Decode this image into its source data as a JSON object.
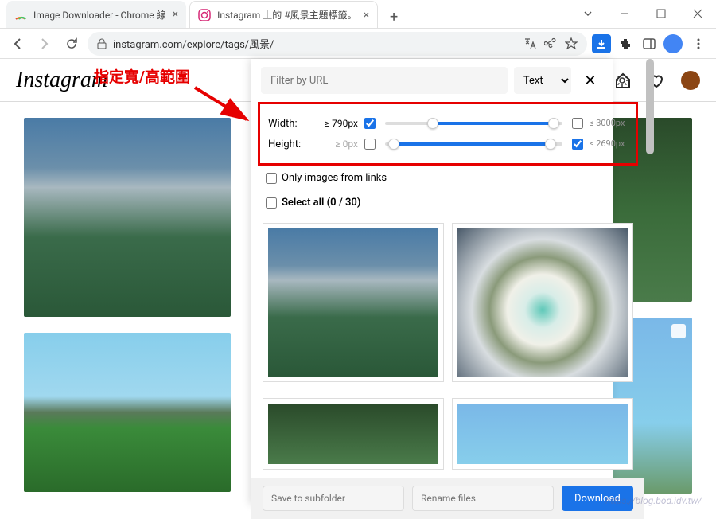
{
  "window": {
    "tabs": [
      {
        "title": "Image Downloader - Chrome 線",
        "active": false
      },
      {
        "title": "Instagram 上的 #風景主題標籤。",
        "active": true
      }
    ]
  },
  "toolbar": {
    "url": "instagram.com/explore/tags/風景/"
  },
  "instagram": {
    "logo": "Instagram"
  },
  "annotation": {
    "text": "指定寬/高範圍"
  },
  "popup": {
    "filter_placeholder": "Filter by URL",
    "text_select": "Text",
    "width_label": "Width:",
    "width_min": "≥ 790px",
    "width_min_checked": true,
    "width_max": "≤ 3000px",
    "width_max_checked": false,
    "height_label": "Height:",
    "height_min": "≥ 0px",
    "height_min_checked": false,
    "height_max": "≤ 2690px",
    "height_max_checked": true,
    "only_links": "Only images from links",
    "select_all": "Select all (0 / 30)",
    "save_subfolder": "Save to subfolder",
    "rename_files": "Rename files",
    "download": "Download"
  },
  "watermark": "https://blog.bod.idv.tw/"
}
